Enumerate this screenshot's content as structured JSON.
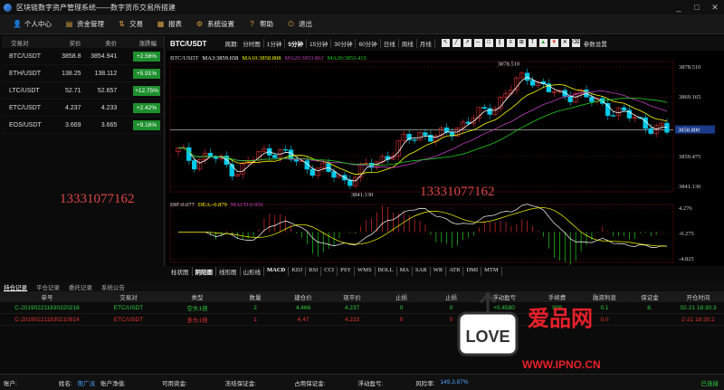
{
  "window": {
    "title": "区块链数字资产管理系统——数字货币交易所搭建",
    "minimize": "_",
    "maximize": "□",
    "close": "✕"
  },
  "menu": [
    {
      "label": "个人中心",
      "icon": "user-icon",
      "glyph": "👤"
    },
    {
      "label": "资金管理",
      "icon": "wallet-icon",
      "glyph": "▤"
    },
    {
      "label": "交易",
      "icon": "trade-icon",
      "glyph": "⇅"
    },
    {
      "label": "报表",
      "icon": "report-icon",
      "glyph": "▦"
    },
    {
      "label": "系统设置",
      "icon": "gear-icon",
      "glyph": "⚙"
    },
    {
      "label": "帮助",
      "icon": "help-icon",
      "glyph": "?"
    },
    {
      "label": "退出",
      "icon": "exit-icon",
      "glyph": "⏻"
    }
  ],
  "market": {
    "headers": {
      "pair": "交易对",
      "buy": "买价",
      "sell": "卖价",
      "change": "涨跌幅"
    },
    "rows": [
      {
        "pair": "BTC/USDT",
        "buy": "3858.8",
        "sell": "3854.941",
        "change": "+2.56%"
      },
      {
        "pair": "ETH/USDT",
        "buy": "138.25",
        "sell": "138.112",
        "change": "+5.91%"
      },
      {
        "pair": "LTC/USDT",
        "buy": "52.71",
        "sell": "52.657",
        "change": "+12.75%"
      },
      {
        "pair": "ETC/USDT",
        "buy": "4.237",
        "sell": "4.233",
        "change": "+2.42%"
      },
      {
        "pair": "EOS/USDT",
        "buy": "3.669",
        "sell": "3.665",
        "change": "+9.16%"
      }
    ],
    "watermark": "13331077162"
  },
  "chart": {
    "symbol": "BTC/USDT",
    "period_label": "周期:",
    "periods": [
      "分时图",
      "1分钟",
      "5分钟",
      "15分钟",
      "30分钟",
      "60分钟",
      "日线",
      "周线",
      "月线"
    ],
    "active_period": "5分钟",
    "settings_label": "参数设置",
    "ma_legend": {
      "title": "BTC/USDT",
      "ma3": "MA3:3859.658",
      "ma10": "MA10:3858.808",
      "ma20": "MA20:3853.863",
      "ma30": "MA30:3853.415"
    },
    "price_labels": [
      "3878.510",
      "3869.165",
      "3858.800",
      "3850.475",
      "3841.130"
    ],
    "current_price": "3858.800",
    "high_annotation": "3878.510",
    "low_annotation": "3841.130",
    "watermark": "13331077162",
    "macd_legend": {
      "dif": "DIF:0.077",
      "dea": "DEA:-0.879",
      "macd": "MACD:0.956"
    },
    "macd_labels": [
      "4.276",
      "-0.275",
      "-4.825"
    ],
    "indicator_tabs": [
      "柱状图",
      "阴阳图",
      "线形图",
      "山形线",
      "MACD",
      "KDJ",
      "RSI",
      "CCI",
      "PSY",
      "WMS",
      "BOLL",
      "MA",
      "SAR",
      "WR",
      "ATR",
      "DMI",
      "MTM"
    ],
    "bold_tabs": [
      "阴阳图",
      "MACD"
    ],
    "colors": {
      "up": "#e03030",
      "down": "#00c8e8",
      "ma3": "#ffffff",
      "ma10": "#ffff00",
      "ma20": "#c040c0",
      "ma30": "#20d020"
    }
  },
  "positions": {
    "tabs": [
      "持仓记录",
      "平仓记录",
      "委托记录",
      "系统公告"
    ],
    "active_tab": "持仓记录",
    "headers": [
      "单号",
      "交易对",
      "类型",
      "数量",
      "建仓价",
      "现平价",
      "止损",
      "止损",
      "浮动盈亏",
      "手续费",
      "融资利息",
      "保证金",
      "开仓时间"
    ],
    "rows": [
      {
        "id": "C-201902211830320218",
        "pair": "ETC/USDT",
        "type": "空头1倍",
        "qty": "2",
        "open": "4.466",
        "now": "4.237",
        "sl": "0",
        "tp": "0",
        "pnl": "+0.4580",
        "fee": "909",
        "interest": "0.1",
        "margin": "8.",
        "time": "02-21 18:30:3",
        "color": "#2ecc40"
      },
      {
        "id": "C-201902211830210814",
        "pair": "ETC/USDT",
        "type": "多头1倍",
        "qty": "1",
        "open": "4.47",
        "now": "4.233",
        "sl": "0",
        "tp": "0",
        "pnl": "-0.",
        "fee": "",
        "interest": "0.0",
        "margin": "",
        "time": "2-21 18:30:2",
        "color": "#e03030"
      }
    ]
  },
  "status": {
    "account_label": "账户:",
    "name_label": "姓名:",
    "name_value": "熊广派",
    "net_label": "账户净值:",
    "available_label": "可用资金:",
    "frozen_label": "冻结保证金:",
    "used_label": "占用保证金:",
    "float_label": "浮动盈亏:",
    "risk_label": "风险率:",
    "risk_value": "149.3.87%",
    "connection": "已连接"
  },
  "stamp": {
    "brand": "爱品网",
    "love": "LOVE",
    "url": "WWW.IPNO.CN"
  }
}
